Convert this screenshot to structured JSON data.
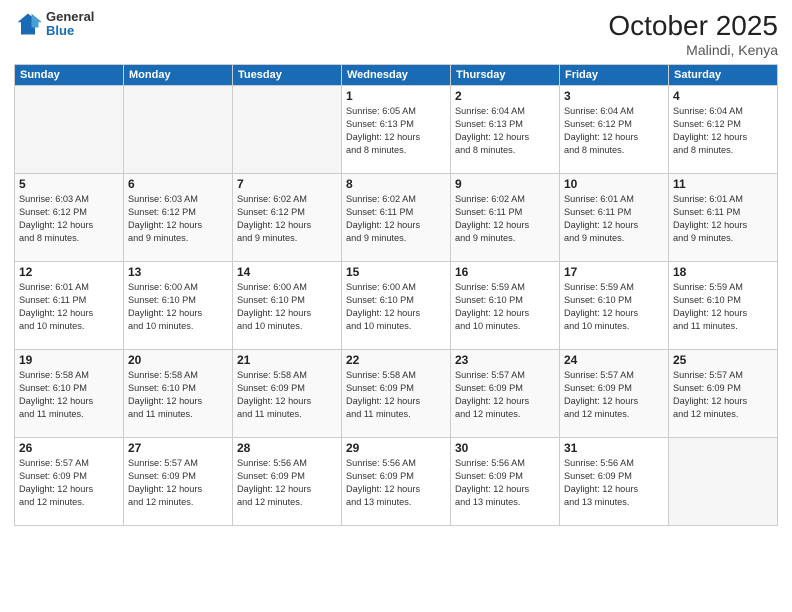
{
  "logo": {
    "general": "General",
    "blue": "Blue"
  },
  "title": "October 2025",
  "location": "Malindi, Kenya",
  "days_header": [
    "Sunday",
    "Monday",
    "Tuesday",
    "Wednesday",
    "Thursday",
    "Friday",
    "Saturday"
  ],
  "weeks": [
    [
      {
        "day": "",
        "info": ""
      },
      {
        "day": "",
        "info": ""
      },
      {
        "day": "",
        "info": ""
      },
      {
        "day": "1",
        "info": "Sunrise: 6:05 AM\nSunset: 6:13 PM\nDaylight: 12 hours\nand 8 minutes."
      },
      {
        "day": "2",
        "info": "Sunrise: 6:04 AM\nSunset: 6:13 PM\nDaylight: 12 hours\nand 8 minutes."
      },
      {
        "day": "3",
        "info": "Sunrise: 6:04 AM\nSunset: 6:12 PM\nDaylight: 12 hours\nand 8 minutes."
      },
      {
        "day": "4",
        "info": "Sunrise: 6:04 AM\nSunset: 6:12 PM\nDaylight: 12 hours\nand 8 minutes."
      }
    ],
    [
      {
        "day": "5",
        "info": "Sunrise: 6:03 AM\nSunset: 6:12 PM\nDaylight: 12 hours\nand 8 minutes."
      },
      {
        "day": "6",
        "info": "Sunrise: 6:03 AM\nSunset: 6:12 PM\nDaylight: 12 hours\nand 9 minutes."
      },
      {
        "day": "7",
        "info": "Sunrise: 6:02 AM\nSunset: 6:12 PM\nDaylight: 12 hours\nand 9 minutes."
      },
      {
        "day": "8",
        "info": "Sunrise: 6:02 AM\nSunset: 6:11 PM\nDaylight: 12 hours\nand 9 minutes."
      },
      {
        "day": "9",
        "info": "Sunrise: 6:02 AM\nSunset: 6:11 PM\nDaylight: 12 hours\nand 9 minutes."
      },
      {
        "day": "10",
        "info": "Sunrise: 6:01 AM\nSunset: 6:11 PM\nDaylight: 12 hours\nand 9 minutes."
      },
      {
        "day": "11",
        "info": "Sunrise: 6:01 AM\nSunset: 6:11 PM\nDaylight: 12 hours\nand 9 minutes."
      }
    ],
    [
      {
        "day": "12",
        "info": "Sunrise: 6:01 AM\nSunset: 6:11 PM\nDaylight: 12 hours\nand 10 minutes."
      },
      {
        "day": "13",
        "info": "Sunrise: 6:00 AM\nSunset: 6:10 PM\nDaylight: 12 hours\nand 10 minutes."
      },
      {
        "day": "14",
        "info": "Sunrise: 6:00 AM\nSunset: 6:10 PM\nDaylight: 12 hours\nand 10 minutes."
      },
      {
        "day": "15",
        "info": "Sunrise: 6:00 AM\nSunset: 6:10 PM\nDaylight: 12 hours\nand 10 minutes."
      },
      {
        "day": "16",
        "info": "Sunrise: 5:59 AM\nSunset: 6:10 PM\nDaylight: 12 hours\nand 10 minutes."
      },
      {
        "day": "17",
        "info": "Sunrise: 5:59 AM\nSunset: 6:10 PM\nDaylight: 12 hours\nand 10 minutes."
      },
      {
        "day": "18",
        "info": "Sunrise: 5:59 AM\nSunset: 6:10 PM\nDaylight: 12 hours\nand 11 minutes."
      }
    ],
    [
      {
        "day": "19",
        "info": "Sunrise: 5:58 AM\nSunset: 6:10 PM\nDaylight: 12 hours\nand 11 minutes."
      },
      {
        "day": "20",
        "info": "Sunrise: 5:58 AM\nSunset: 6:10 PM\nDaylight: 12 hours\nand 11 minutes."
      },
      {
        "day": "21",
        "info": "Sunrise: 5:58 AM\nSunset: 6:09 PM\nDaylight: 12 hours\nand 11 minutes."
      },
      {
        "day": "22",
        "info": "Sunrise: 5:58 AM\nSunset: 6:09 PM\nDaylight: 12 hours\nand 11 minutes."
      },
      {
        "day": "23",
        "info": "Sunrise: 5:57 AM\nSunset: 6:09 PM\nDaylight: 12 hours\nand 12 minutes."
      },
      {
        "day": "24",
        "info": "Sunrise: 5:57 AM\nSunset: 6:09 PM\nDaylight: 12 hours\nand 12 minutes."
      },
      {
        "day": "25",
        "info": "Sunrise: 5:57 AM\nSunset: 6:09 PM\nDaylight: 12 hours\nand 12 minutes."
      }
    ],
    [
      {
        "day": "26",
        "info": "Sunrise: 5:57 AM\nSunset: 6:09 PM\nDaylight: 12 hours\nand 12 minutes."
      },
      {
        "day": "27",
        "info": "Sunrise: 5:57 AM\nSunset: 6:09 PM\nDaylight: 12 hours\nand 12 minutes."
      },
      {
        "day": "28",
        "info": "Sunrise: 5:56 AM\nSunset: 6:09 PM\nDaylight: 12 hours\nand 12 minutes."
      },
      {
        "day": "29",
        "info": "Sunrise: 5:56 AM\nSunset: 6:09 PM\nDaylight: 12 hours\nand 13 minutes."
      },
      {
        "day": "30",
        "info": "Sunrise: 5:56 AM\nSunset: 6:09 PM\nDaylight: 12 hours\nand 13 minutes."
      },
      {
        "day": "31",
        "info": "Sunrise: 5:56 AM\nSunset: 6:09 PM\nDaylight: 12 hours\nand 13 minutes."
      },
      {
        "day": "",
        "info": ""
      }
    ]
  ]
}
